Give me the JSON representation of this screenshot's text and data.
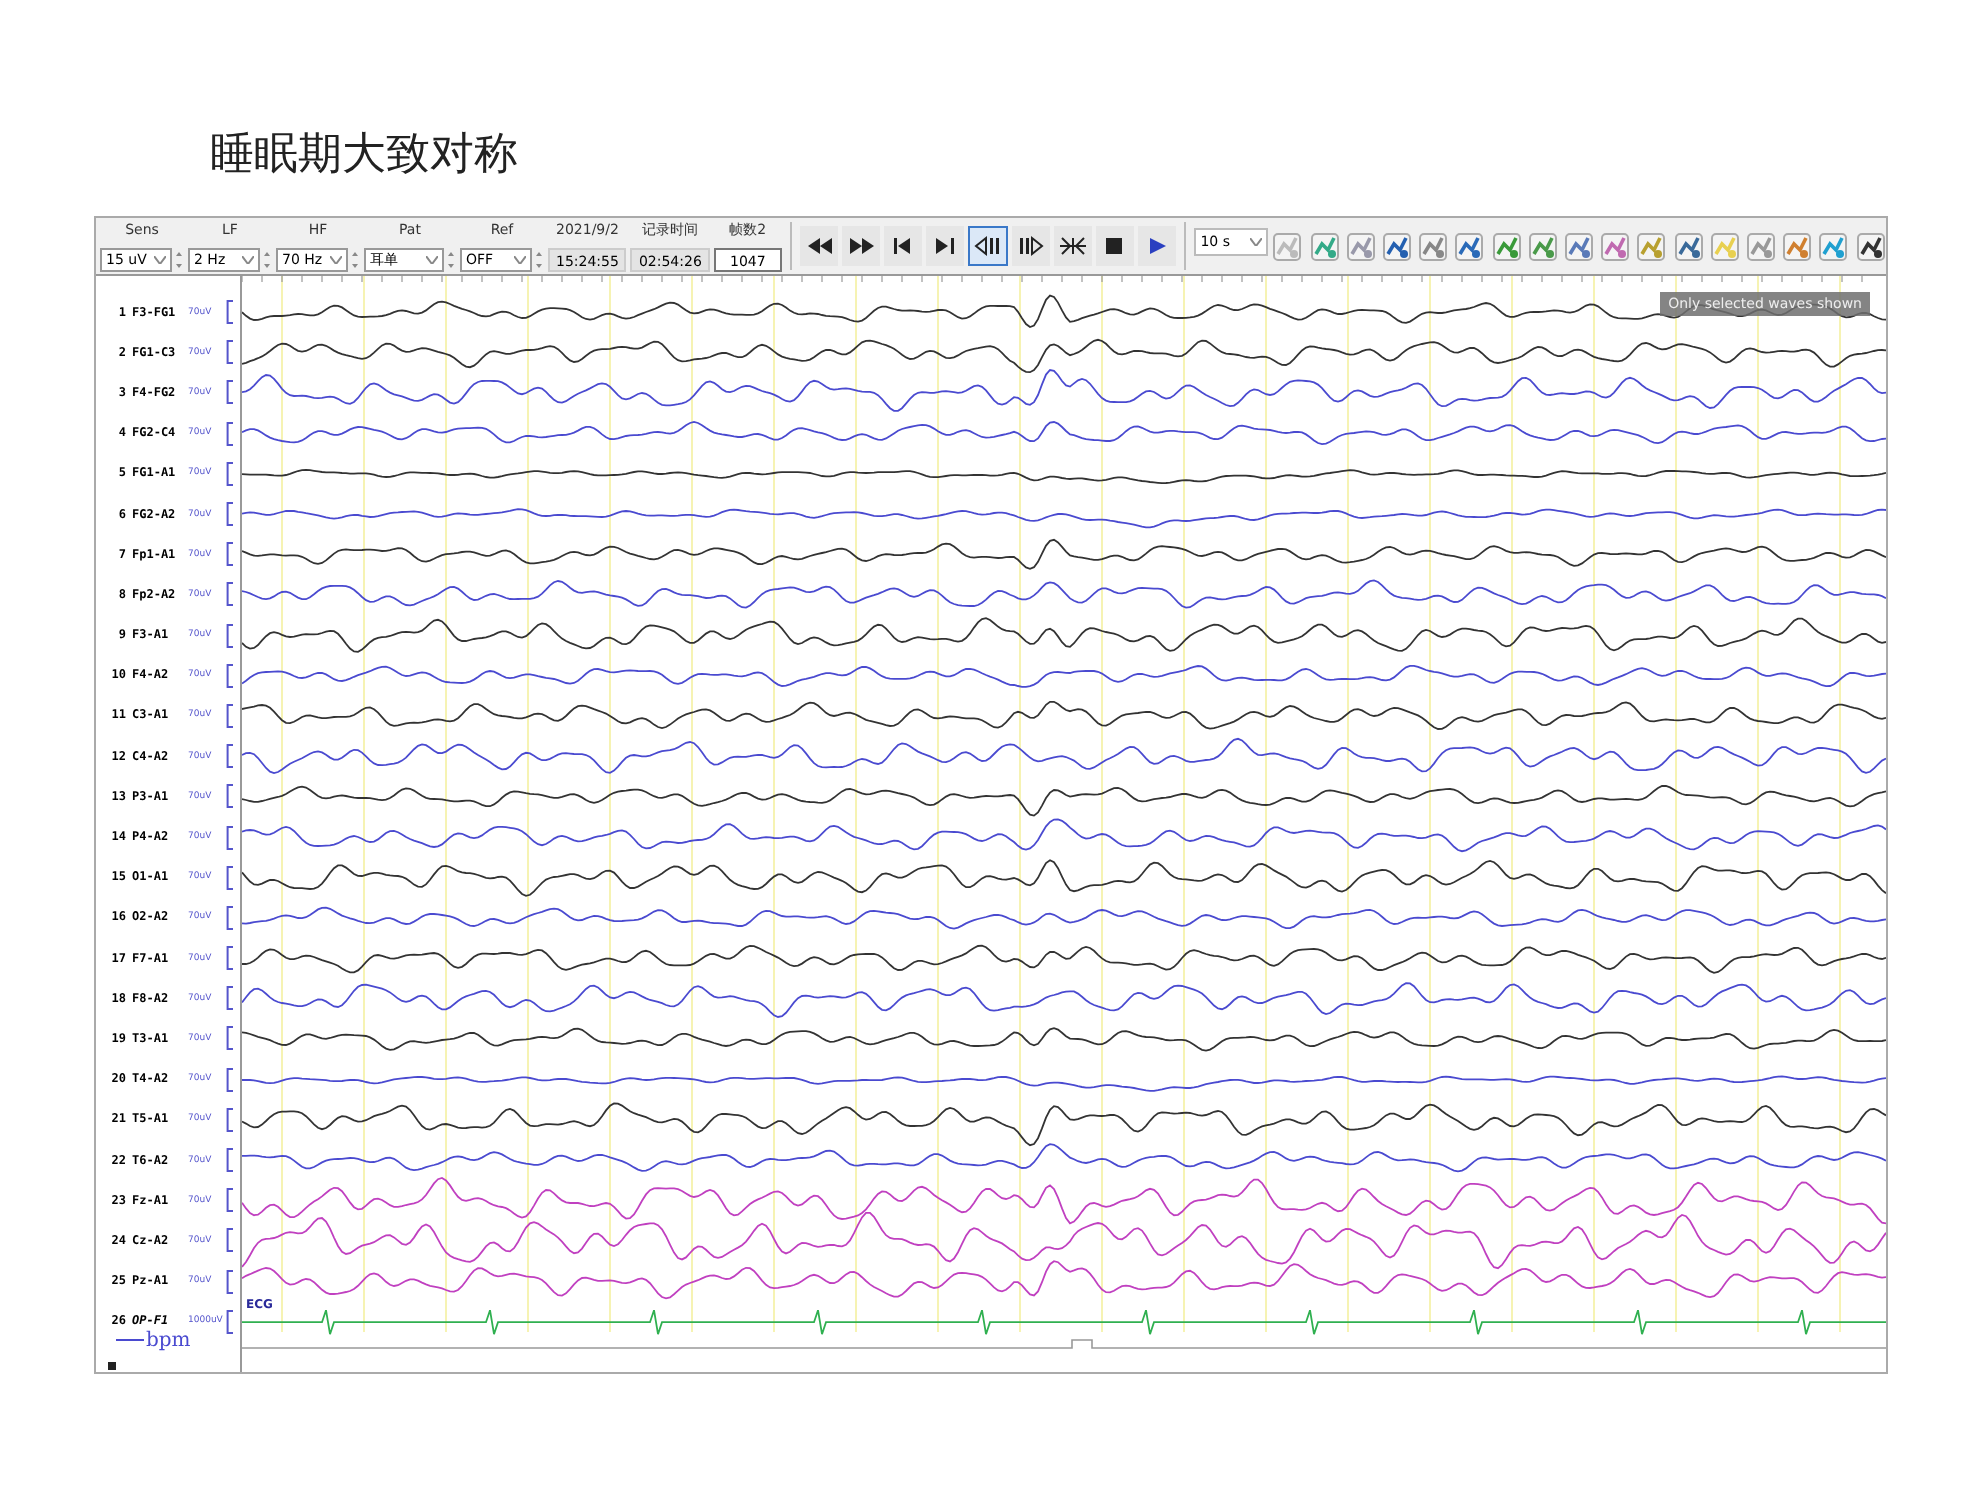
{
  "slide_title": "睡眠期大致对称",
  "toolbar": {
    "selects": [
      {
        "label": "Sens",
        "value": "15 uV"
      },
      {
        "label": "LF",
        "value": "2 Hz"
      },
      {
        "label": "HF",
        "value": "70 Hz"
      },
      {
        "label": "Pat",
        "value": "耳单"
      },
      {
        "label": "Ref",
        "value": "OFF"
      }
    ],
    "readouts": [
      {
        "label": "2021/9/2",
        "value": "15:24:55"
      },
      {
        "label": "记录时间",
        "value": "02:54:26"
      },
      {
        "label": "帧数2",
        "value": "1047",
        "kind": "box"
      }
    ],
    "playback": [
      {
        "kind": "rewind",
        "selected": false
      },
      {
        "kind": "forward",
        "selected": false
      },
      {
        "kind": "first",
        "selected": false
      },
      {
        "kind": "last",
        "selected": false
      },
      {
        "kind": "step-back",
        "selected": true
      },
      {
        "kind": "step-forward",
        "selected": false
      },
      {
        "kind": "collapse",
        "selected": false
      },
      {
        "kind": "stop",
        "selected": false
      },
      {
        "kind": "play",
        "selected": false
      }
    ],
    "timebase": "10 s"
  },
  "badge": "Only selected waves shown",
  "channels": [
    {
      "number": "1",
      "name": "F3-FG1",
      "scale": "70uV",
      "color": "#333333"
    },
    {
      "number": "2",
      "name": "FG1-C3",
      "scale": "70uV",
      "color": "#333333"
    },
    {
      "number": "3",
      "name": "F4-FG2",
      "scale": "70uV",
      "color": "#4a4ad0"
    },
    {
      "number": "4",
      "name": "FG2-C4",
      "scale": "70uV",
      "color": "#4a4ad0"
    },
    {
      "number": "5",
      "name": "FG1-A1",
      "scale": "70uV",
      "color": "#333333"
    },
    {
      "number": "6",
      "name": "FG2-A2",
      "scale": "70uV",
      "color": "#4a4ad0"
    },
    {
      "number": "7",
      "name": "Fp1-A1",
      "scale": "70uV",
      "color": "#333333"
    },
    {
      "number": "8",
      "name": "Fp2-A2",
      "scale": "70uV",
      "color": "#4a4ad0"
    },
    {
      "number": "9",
      "name": "F3-A1",
      "scale": "70uV",
      "color": "#333333"
    },
    {
      "number": "10",
      "name": "F4-A2",
      "scale": "70uV",
      "color": "#4a4ad0"
    },
    {
      "number": "11",
      "name": "C3-A1",
      "scale": "70uV",
      "color": "#333333"
    },
    {
      "number": "12",
      "name": "C4-A2",
      "scale": "70uV",
      "color": "#4a4ad0"
    },
    {
      "number": "13",
      "name": "P3-A1",
      "scale": "70uV",
      "color": "#333333"
    },
    {
      "number": "14",
      "name": "P4-A2",
      "scale": "70uV",
      "color": "#4a4ad0"
    },
    {
      "number": "15",
      "name": "O1-A1",
      "scale": "70uV",
      "color": "#333333"
    },
    {
      "number": "16",
      "name": "O2-A2",
      "scale": "70uV",
      "color": "#4a4ad0"
    },
    {
      "number": "17",
      "name": "F7-A1",
      "scale": "70uV",
      "color": "#333333"
    },
    {
      "number": "18",
      "name": "F8-A2",
      "scale": "70uV",
      "color": "#4a4ad0"
    },
    {
      "number": "19",
      "name": "T3-A1",
      "scale": "70uV",
      "color": "#333333"
    },
    {
      "number": "20",
      "name": "T4-A2",
      "scale": "70uV",
      "color": "#4a4ad0"
    },
    {
      "number": "21",
      "name": "T5-A1",
      "scale": "70uV",
      "color": "#333333"
    },
    {
      "number": "22",
      "name": "T6-A2",
      "scale": "70uV",
      "color": "#4a4ad0"
    },
    {
      "number": "23",
      "name": "Fz-A1",
      "scale": "70uV",
      "color": "#c040c0"
    },
    {
      "number": "24",
      "name": "Cz-A2",
      "scale": "70uV",
      "color": "#c040c0"
    },
    {
      "number": "25",
      "name": "Pz-A1",
      "scale": "70uV",
      "color": "#c040c0"
    },
    {
      "number": "26",
      "name": "OP-F1",
      "scale": "1000uV",
      "color": "#30b050",
      "kind": "ecg",
      "tag": "ECG",
      "unit": "bpm"
    }
  ]
}
